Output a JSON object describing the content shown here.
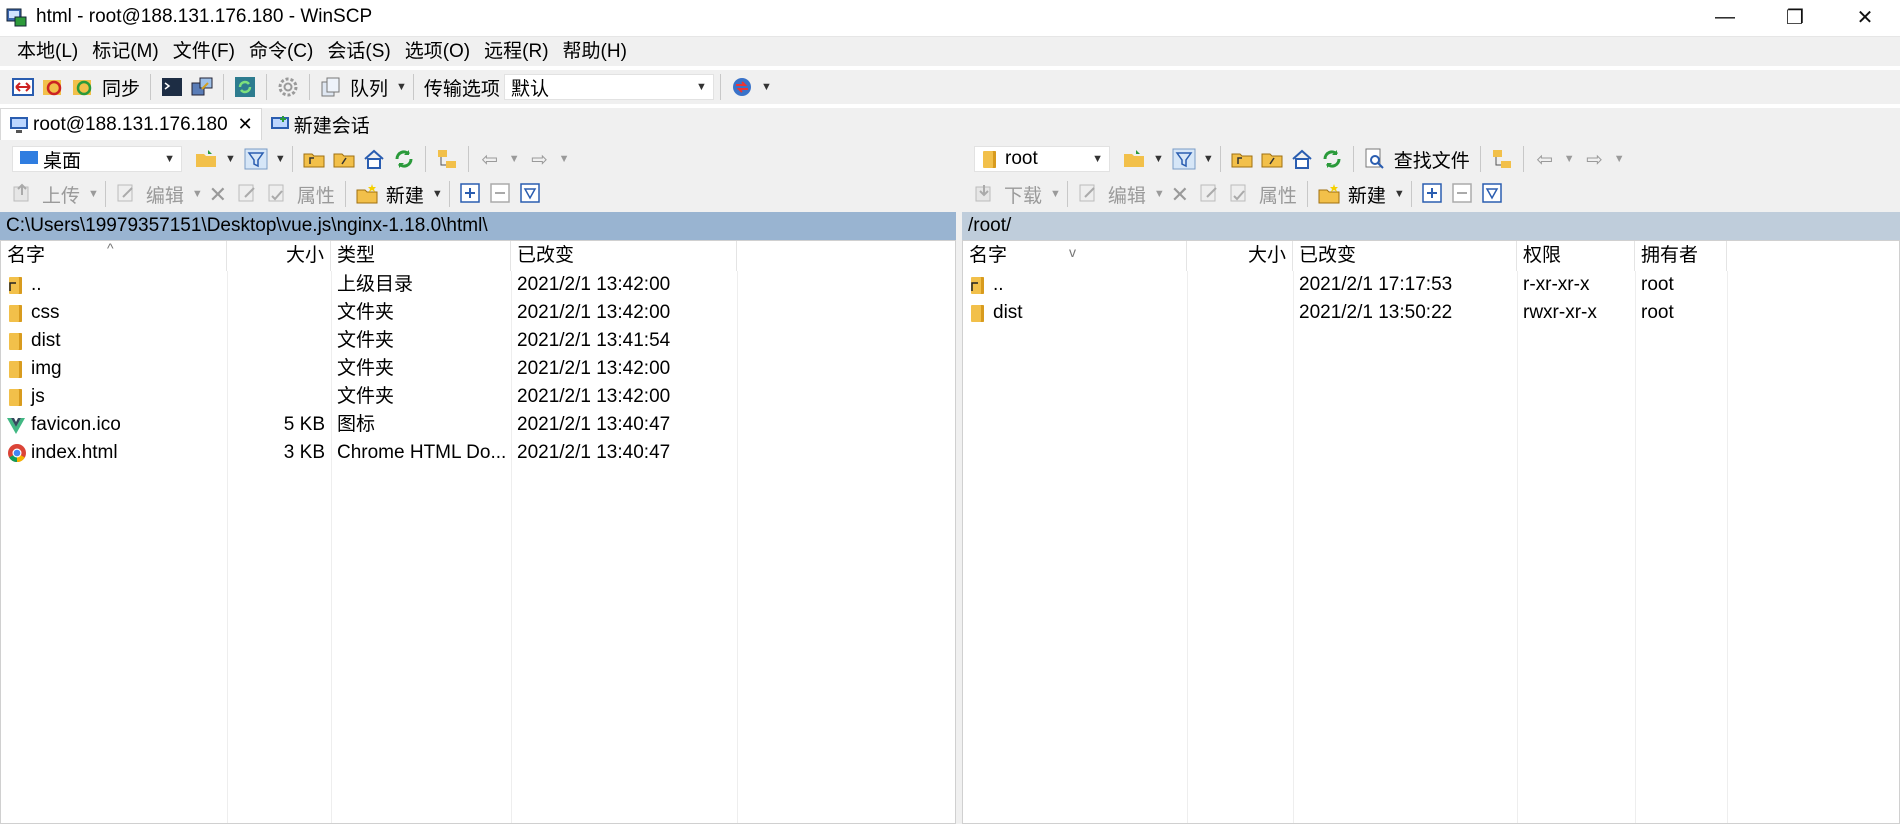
{
  "window": {
    "title": "html - root@188.131.176.180 - WinSCP",
    "minimize_glyph": "—",
    "restore_glyph": "❐",
    "close_glyph": "✕"
  },
  "menu": [
    "本地(L)",
    "标记(M)",
    "文件(F)",
    "命令(C)",
    "会话(S)",
    "选项(O)",
    "远程(R)",
    "帮助(H)"
  ],
  "toolbar": {
    "sync_label": "同步",
    "queue_label": "队列",
    "transfer_options_label": "传输选项",
    "transfer_profile": "默认"
  },
  "tabs": [
    {
      "label": "root@188.131.176.180",
      "close": "✕"
    },
    {
      "label": "新建会话"
    }
  ],
  "local": {
    "location": "桌面",
    "actions": {
      "upload": "上传",
      "edit": "编辑",
      "properties": "属性",
      "new": "新建"
    },
    "path": "C:\\Users\\19979357151\\Desktop\\vue.js\\nginx-1.18.0\\html\\",
    "columns": {
      "name": "名字",
      "size": "大小",
      "type": "类型",
      "modified": "已改变"
    },
    "sort_indicator": "^",
    "files": [
      {
        "name": "..",
        "size": "",
        "type": "上级目录",
        "modified": "2021/2/1  13:42:00",
        "icon": "parent-folder-icon"
      },
      {
        "name": "css",
        "size": "",
        "type": "文件夹",
        "modified": "2021/2/1  13:42:00",
        "icon": "folder-icon"
      },
      {
        "name": "dist",
        "size": "",
        "type": "文件夹",
        "modified": "2021/2/1  13:41:54",
        "icon": "folder-icon"
      },
      {
        "name": "img",
        "size": "",
        "type": "文件夹",
        "modified": "2021/2/1  13:42:00",
        "icon": "folder-icon"
      },
      {
        "name": "js",
        "size": "",
        "type": "文件夹",
        "modified": "2021/2/1  13:42:00",
        "icon": "folder-icon"
      },
      {
        "name": "favicon.ico",
        "size": "5 KB",
        "type": "图标",
        "modified": "2021/2/1  13:40:47",
        "icon": "vue-icon"
      },
      {
        "name": "index.html",
        "size": "3 KB",
        "type": "Chrome HTML Do...",
        "modified": "2021/2/1  13:40:47",
        "icon": "chrome-icon"
      }
    ]
  },
  "remote": {
    "location": "root",
    "find_files_label": "查找文件",
    "actions": {
      "download": "下载",
      "edit": "编辑",
      "properties": "属性",
      "new": "新建"
    },
    "path": "/root/",
    "columns": {
      "name": "名字",
      "size": "大小",
      "modified": "已改变",
      "permissions": "权限",
      "owner": "拥有者"
    },
    "sort_indicator": "v",
    "files": [
      {
        "name": "..",
        "modified": "2021/2/1 17:17:53",
        "permissions": "r-xr-xr-x",
        "owner": "root",
        "icon": "parent-folder-icon"
      },
      {
        "name": "dist",
        "modified": "2021/2/1 13:50:22",
        "permissions": "rwxr-xr-x",
        "owner": "root",
        "icon": "folder-icon"
      }
    ]
  },
  "colors": {
    "local_path_bg": "#99b4d1",
    "remote_path_bg": "#bfcddb",
    "folder": "#f2c04a",
    "chrome_blue": "#4285f4",
    "vue_green": "#41b883"
  }
}
